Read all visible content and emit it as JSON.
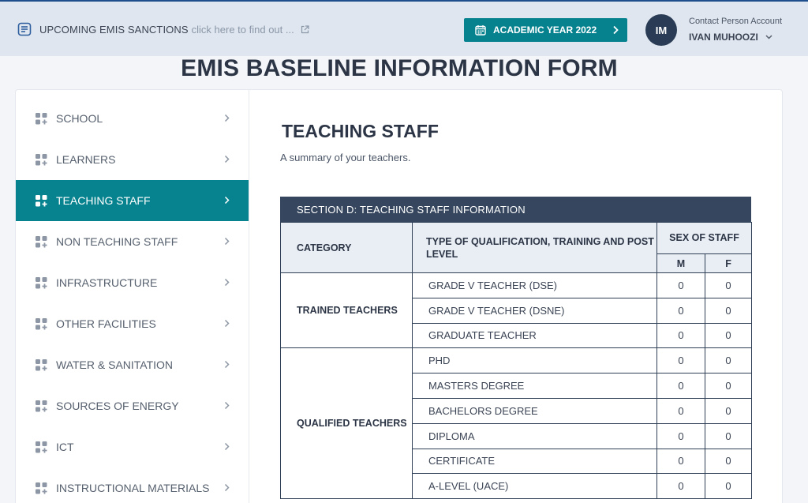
{
  "notice": {
    "title": "UPCOMING EMIS SANCTIONS",
    "link_text": "click here to find out ..."
  },
  "header": {
    "year_button_label": "ACADEMIC YEAR 2022"
  },
  "account": {
    "initials": "IM",
    "role": "Contact Person Account",
    "name": "IVAN MUHOOZI"
  },
  "page": {
    "title": "EMIS BASELINE INFORMATION FORM"
  },
  "sidebar": {
    "items": [
      {
        "label": "SCHOOL",
        "active": false
      },
      {
        "label": "LEARNERS",
        "active": false
      },
      {
        "label": "TEACHING STAFF",
        "active": true
      },
      {
        "label": "NON TEACHING STAFF",
        "active": false
      },
      {
        "label": "INFRASTRUCTURE",
        "active": false
      },
      {
        "label": "OTHER FACILITIES",
        "active": false
      },
      {
        "label": "WATER & SANITATION",
        "active": false
      },
      {
        "label": "SOURCES OF ENERGY",
        "active": false
      },
      {
        "label": "ICT",
        "active": false
      },
      {
        "label": "INSTRUCTIONAL MATERIALS",
        "active": false
      }
    ]
  },
  "section": {
    "title": "TEACHING STAFF",
    "subtitle": "A summary of your teachers."
  },
  "table": {
    "heading": "SECTION D: TEACHING STAFF INFORMATION",
    "col_category": "CATEGORY",
    "col_type": "TYPE OF QUALIFICATION, TRAINING AND POST LEVEL",
    "col_sex": "SEX OF STAFF",
    "col_m": "M",
    "col_f": "F",
    "groups": [
      {
        "category": "TRAINED TEACHERS",
        "rows": [
          {
            "type": "GRADE V TEACHER (DSE)",
            "m": "0",
            "f": "0"
          },
          {
            "type": "GRADE V TEACHER (DSNE)",
            "m": "0",
            "f": "0"
          },
          {
            "type": "GRADUATE TEACHER",
            "m": "0",
            "f": "0"
          }
        ]
      },
      {
        "category": "QUALIFIED TEACHERS",
        "rows": [
          {
            "type": "PHD",
            "m": "0",
            "f": "0"
          },
          {
            "type": "MASTERS DEGREE",
            "m": "0",
            "f": "0"
          },
          {
            "type": "BACHELORS DEGREE",
            "m": "0",
            "f": "0"
          },
          {
            "type": "DIPLOMA",
            "m": "0",
            "f": "0"
          },
          {
            "type": "CERTIFICATE",
            "m": "0",
            "f": "0"
          },
          {
            "type": "A-LEVEL (UACE)",
            "m": "0",
            "f": "0"
          }
        ]
      }
    ]
  },
  "colors": {
    "accent": "#07838f",
    "navy": "#35465e",
    "avatar": "#2a3c55",
    "topbar": "#dfe6ef"
  }
}
